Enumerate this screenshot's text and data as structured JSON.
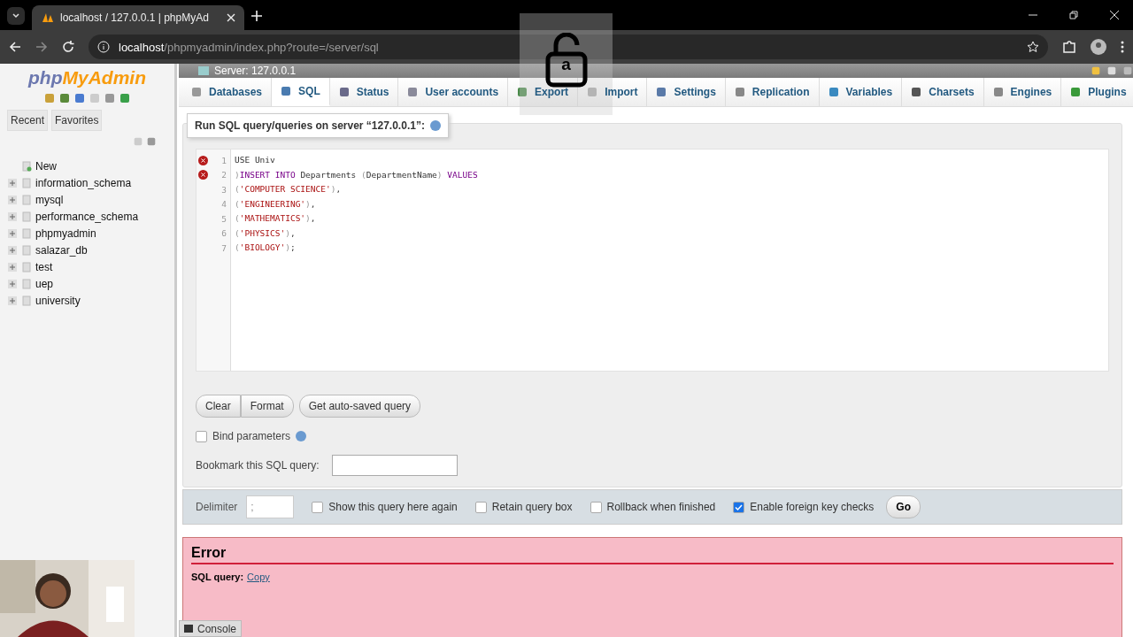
{
  "browser": {
    "tab_title": "localhost / 127.0.0.1 | phpMyAd",
    "url_host": "localhost",
    "url_path": "/phpmyadmin/index.php?route=/server/sql"
  },
  "overlay": {
    "key": "a"
  },
  "sidebar": {
    "logo_php": "php",
    "logo_rest": "MyAdmin",
    "tabs": [
      {
        "label": "Recent",
        "selected": false
      },
      {
        "label": "Favorites",
        "selected": false
      }
    ],
    "tree": [
      {
        "label": "New",
        "kind": "new"
      },
      {
        "label": "information_schema",
        "kind": "db"
      },
      {
        "label": "mysql",
        "kind": "db"
      },
      {
        "label": "performance_schema",
        "kind": "db"
      },
      {
        "label": "phpmyadmin",
        "kind": "db"
      },
      {
        "label": "salazar_db",
        "kind": "db"
      },
      {
        "label": "test",
        "kind": "db"
      },
      {
        "label": "uep",
        "kind": "db"
      },
      {
        "label": "university",
        "kind": "db"
      }
    ]
  },
  "breadcrumb": "Server: 127.0.0.1",
  "tabs": [
    {
      "label": "Databases",
      "selected": false
    },
    {
      "label": "SQL",
      "selected": true
    },
    {
      "label": "Status",
      "selected": false
    },
    {
      "label": "User accounts",
      "selected": false
    },
    {
      "label": "Export",
      "selected": false
    },
    {
      "label": "Import",
      "selected": false
    },
    {
      "label": "Settings",
      "selected": false
    },
    {
      "label": "Replication",
      "selected": false
    },
    {
      "label": "Variables",
      "selected": false
    },
    {
      "label": "Charsets",
      "selected": false
    },
    {
      "label": "Engines",
      "selected": false
    },
    {
      "label": "Plugins",
      "selected": false
    }
  ],
  "query_panel": {
    "title": "Run SQL query/queries on server “127.0.0.1”:",
    "lines": [
      {
        "number": "1",
        "error": true,
        "tokens": [
          {
            "kind": "plain",
            "text": "USE Univ"
          }
        ]
      },
      {
        "number": "2",
        "error": true,
        "tokens": [
          {
            "kind": "punct",
            "text": ")"
          },
          {
            "kind": "keyword",
            "text": "INSERT INTO"
          },
          {
            "kind": "plain",
            "text": " Departments "
          },
          {
            "kind": "punct",
            "text": "("
          },
          {
            "kind": "plain",
            "text": "DepartmentName"
          },
          {
            "kind": "punct",
            "text": ") "
          },
          {
            "kind": "keyword",
            "text": "VALUES"
          }
        ]
      },
      {
        "number": "3",
        "error": false,
        "tokens": [
          {
            "kind": "punct",
            "text": "("
          },
          {
            "kind": "string",
            "text": "'COMPUTER SCIENCE'"
          },
          {
            "kind": "punct",
            "text": ")"
          },
          {
            "kind": "plain",
            "text": ","
          }
        ]
      },
      {
        "number": "4",
        "error": false,
        "tokens": [
          {
            "kind": "punct",
            "text": "("
          },
          {
            "kind": "string",
            "text": "'ENGINEERING'"
          },
          {
            "kind": "punct",
            "text": ")"
          },
          {
            "kind": "plain",
            "text": ","
          }
        ]
      },
      {
        "number": "5",
        "error": false,
        "tokens": [
          {
            "kind": "punct",
            "text": "("
          },
          {
            "kind": "string",
            "text": "'MATHEMATICS'"
          },
          {
            "kind": "punct",
            "text": ")"
          },
          {
            "kind": "plain",
            "text": ","
          }
        ]
      },
      {
        "number": "6",
        "error": false,
        "tokens": [
          {
            "kind": "punct",
            "text": "("
          },
          {
            "kind": "string",
            "text": "'PHYSICS'"
          },
          {
            "kind": "punct",
            "text": ")"
          },
          {
            "kind": "plain",
            "text": ","
          }
        ]
      },
      {
        "number": "7",
        "error": false,
        "tokens": [
          {
            "kind": "punct",
            "text": "("
          },
          {
            "kind": "string",
            "text": "'BIOLOGY'"
          },
          {
            "kind": "punct",
            "text": ")"
          },
          {
            "kind": "plain",
            "text": ";"
          }
        ]
      }
    ],
    "buttons": [
      "Clear",
      "Format",
      "Get auto-saved query"
    ],
    "bind_parameters": {
      "label": "Bind parameters",
      "checked": false
    },
    "bookmark_label": "Bookmark this SQL query:"
  },
  "options": {
    "delimiter_label": "Delimiter",
    "delimiter_value": ";",
    "checks": [
      {
        "label": "Show this query here again",
        "checked": false
      },
      {
        "label": "Retain query box",
        "checked": false
      },
      {
        "label": "Rollback when finished",
        "checked": false
      },
      {
        "label": "Enable foreign key checks",
        "checked": true
      }
    ],
    "go": "Go"
  },
  "error": {
    "title": "Error",
    "label": "SQL query:",
    "link": "Copy"
  },
  "console": "Console"
}
